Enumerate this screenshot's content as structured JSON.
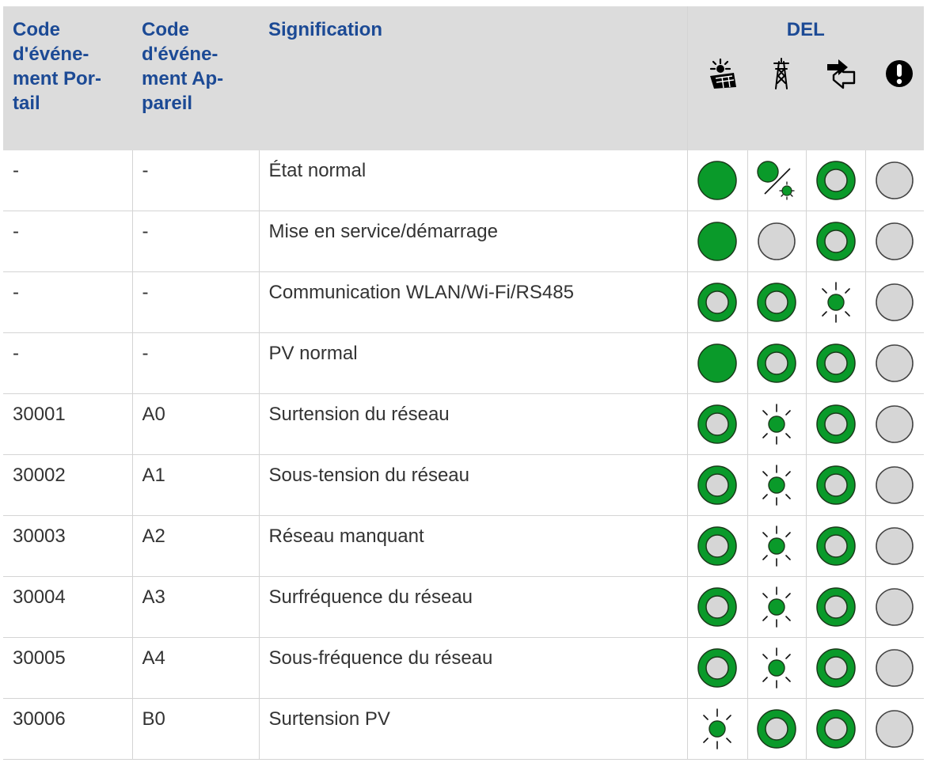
{
  "header": {
    "col1": "Code d'événe-ment Por-tail",
    "col1_lines": [
      "Code",
      "d'événe-",
      "ment Por-",
      "tail"
    ],
    "col2_lines": [
      "Code",
      "d'événe-",
      "ment Ap-",
      "pareil"
    ],
    "col3": "Signification",
    "del": "DEL",
    "led_icons": [
      "sun-panel-icon",
      "grid-tower-icon",
      "communication-arrow-icon",
      "warning-icon"
    ]
  },
  "colors": {
    "header_text": "#1c4a95",
    "header_bg": "#dcdcdc",
    "led_green": "#0a9a2a",
    "led_grey": "#d6d6d6",
    "led_grey_border": "#444444"
  },
  "led_states_legend": {
    "on": "solid green circle",
    "off": "grey circle",
    "green_ring": "grey circle with green ring",
    "blink": "small green dot with rays",
    "on_or_blink": "solid green circle slash blinking dot"
  },
  "rows": [
    {
      "portal": "-",
      "device": "-",
      "meaning": "État normal",
      "leds": [
        "on",
        "on_or_blink",
        "green_ring",
        "off"
      ]
    },
    {
      "portal": "-",
      "device": "-",
      "meaning": "Mise en service/démarrage",
      "leds": [
        "on",
        "off",
        "green_ring",
        "off"
      ]
    },
    {
      "portal": "-",
      "device": "-",
      "meaning": "Communication WLAN/Wi-Fi/RS485",
      "leds": [
        "green_ring",
        "green_ring",
        "blink",
        "off"
      ]
    },
    {
      "portal": "-",
      "device": "-",
      "meaning": "PV normal",
      "leds": [
        "on",
        "green_ring",
        "green_ring",
        "off"
      ]
    },
    {
      "portal": "30001",
      "device": "A0",
      "meaning": "Surtension du réseau",
      "leds": [
        "green_ring",
        "blink",
        "green_ring",
        "off"
      ]
    },
    {
      "portal": "30002",
      "device": "A1",
      "meaning": "Sous-tension du réseau",
      "leds": [
        "green_ring",
        "blink",
        "green_ring",
        "off"
      ]
    },
    {
      "portal": "30003",
      "device": "A2",
      "meaning": "Réseau manquant",
      "leds": [
        "green_ring",
        "blink",
        "green_ring",
        "off"
      ]
    },
    {
      "portal": "30004",
      "device": "A3",
      "meaning": "Surfréquence du réseau",
      "leds": [
        "green_ring",
        "blink",
        "green_ring",
        "off"
      ]
    },
    {
      "portal": "30005",
      "device": "A4",
      "meaning": "Sous-fréquence du réseau",
      "leds": [
        "green_ring",
        "blink",
        "green_ring",
        "off"
      ]
    },
    {
      "portal": "30006",
      "device": "B0",
      "meaning": "Surtension PV",
      "leds": [
        "blink",
        "green_ring",
        "green_ring",
        "off"
      ]
    }
  ]
}
